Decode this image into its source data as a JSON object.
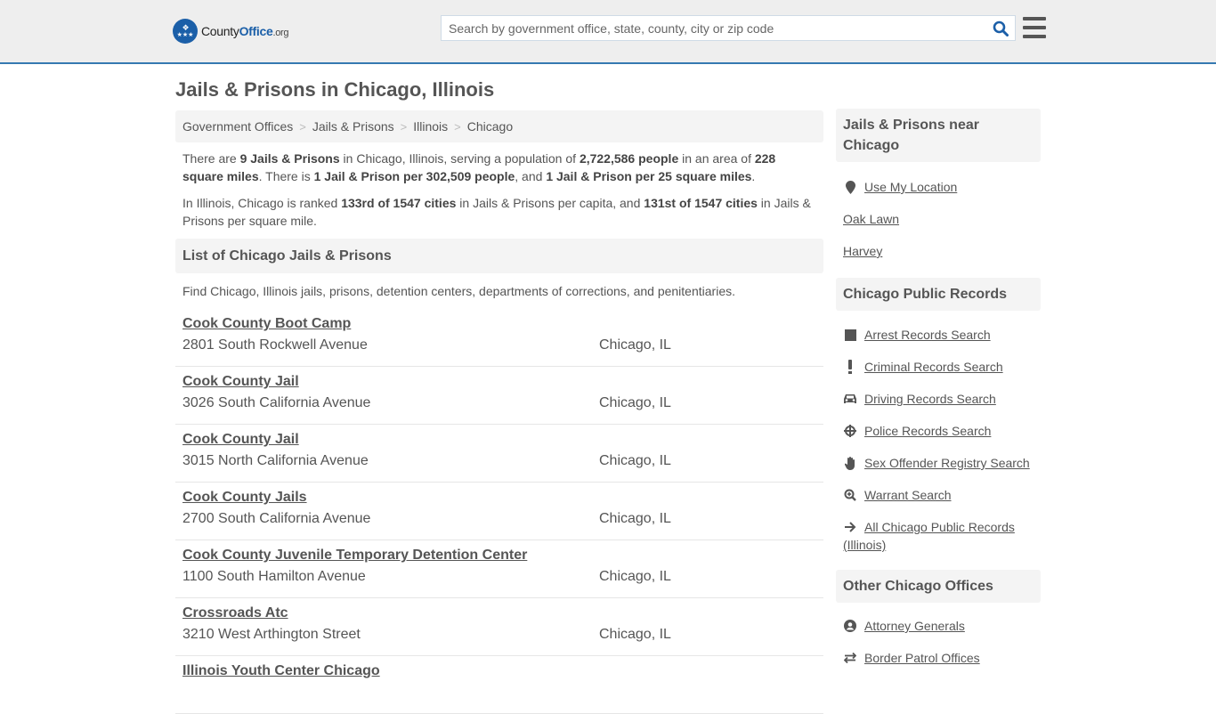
{
  "header": {
    "logo": {
      "county": "County",
      "office": "Office",
      "org": ".org"
    },
    "search": {
      "placeholder": "Search by government office, state, county, city or zip code",
      "value": ""
    },
    "search_icon": "search-icon",
    "menu_icon": "hamburger-menu-icon"
  },
  "page_title": "Jails & Prisons in Chicago, Illinois",
  "breadcrumb": [
    {
      "label": "Government Offices"
    },
    {
      "label": "Jails & Prisons"
    },
    {
      "label": "Illinois"
    },
    {
      "label": "Chicago"
    }
  ],
  "breadcrumb_separator": ">",
  "intro": {
    "p1": {
      "t1": "There are ",
      "b1": "9 Jails & Prisons",
      "t2": " in Chicago, Illinois, serving a population of ",
      "b2": "2,722,586 people",
      "t3": " in an area of ",
      "b3": "228 square miles",
      "t4": ". There is ",
      "b4": "1 Jail & Prison per 302,509 people",
      "t5": ", and ",
      "b5": "1 Jail & Prison per 25 square miles",
      "t6": "."
    },
    "p2": {
      "t1": "In Illinois, Chicago is ranked ",
      "b1": "133rd of 1547 cities",
      "t2": " in Jails & Prisons per capita, and ",
      "b2": "131st of 1547 cities",
      "t3": " in Jails & Prisons per square mile."
    }
  },
  "list_section": {
    "title": "List of Chicago Jails & Prisons",
    "description": "Find Chicago, Illinois jails, prisons, detention centers, departments of corrections, and penitentiaries.",
    "items": [
      {
        "name": "Cook County Boot Camp",
        "address": "2801 South Rockwell Avenue",
        "city": "Chicago, IL"
      },
      {
        "name": "Cook County Jail",
        "address": "3026 South California Avenue",
        "city": "Chicago, IL"
      },
      {
        "name": "Cook County Jail",
        "address": "3015 North California Avenue",
        "city": "Chicago, IL"
      },
      {
        "name": "Cook County Jails",
        "address": "2700 South California Avenue",
        "city": "Chicago, IL"
      },
      {
        "name": "Cook County Juvenile Temporary Detention Center",
        "address": "1100 South Hamilton Avenue",
        "city": "Chicago, IL"
      },
      {
        "name": "Crossroads Atc",
        "address": "3210 West Arthington Street",
        "city": "Chicago, IL"
      },
      {
        "name": "Illinois Youth Center Chicago",
        "address": "",
        "city": ""
      }
    ]
  },
  "sidebar": {
    "nearby": {
      "title": "Jails & Prisons near Chicago",
      "use_location": {
        "label": "Use My Location",
        "icon": "map-marker-icon"
      },
      "places": [
        {
          "label": "Oak Lawn"
        },
        {
          "label": "Harvey"
        }
      ]
    },
    "public_records": {
      "title": "Chicago Public Records",
      "links": [
        {
          "label": "Arrest Records Search",
          "icon": "square-icon"
        },
        {
          "label": "Criminal Records Search",
          "icon": "exclamation-icon"
        },
        {
          "label": "Driving Records Search",
          "icon": "car-icon"
        },
        {
          "label": "Police Records Search",
          "icon": "crosshairs-icon"
        },
        {
          "label": "Sex Offender Registry Search",
          "icon": "hand-icon"
        },
        {
          "label": "Warrant Search",
          "icon": "search-plus-icon"
        },
        {
          "label": "All Chicago Public Records (Illinois)",
          "icon": "arrow-right-icon"
        }
      ]
    },
    "other_offices": {
      "title": "Other Chicago Offices",
      "links": [
        {
          "label": "Attorney Generals",
          "icon": "user-circle-icon"
        },
        {
          "label": "Border Patrol Offices",
          "icon": "exchange-icon"
        }
      ]
    }
  },
  "colors": {
    "brand": "#1b5fa8",
    "header_border": "#3579b1",
    "panel_bg": "#f4f4f4",
    "text": "#555555"
  }
}
